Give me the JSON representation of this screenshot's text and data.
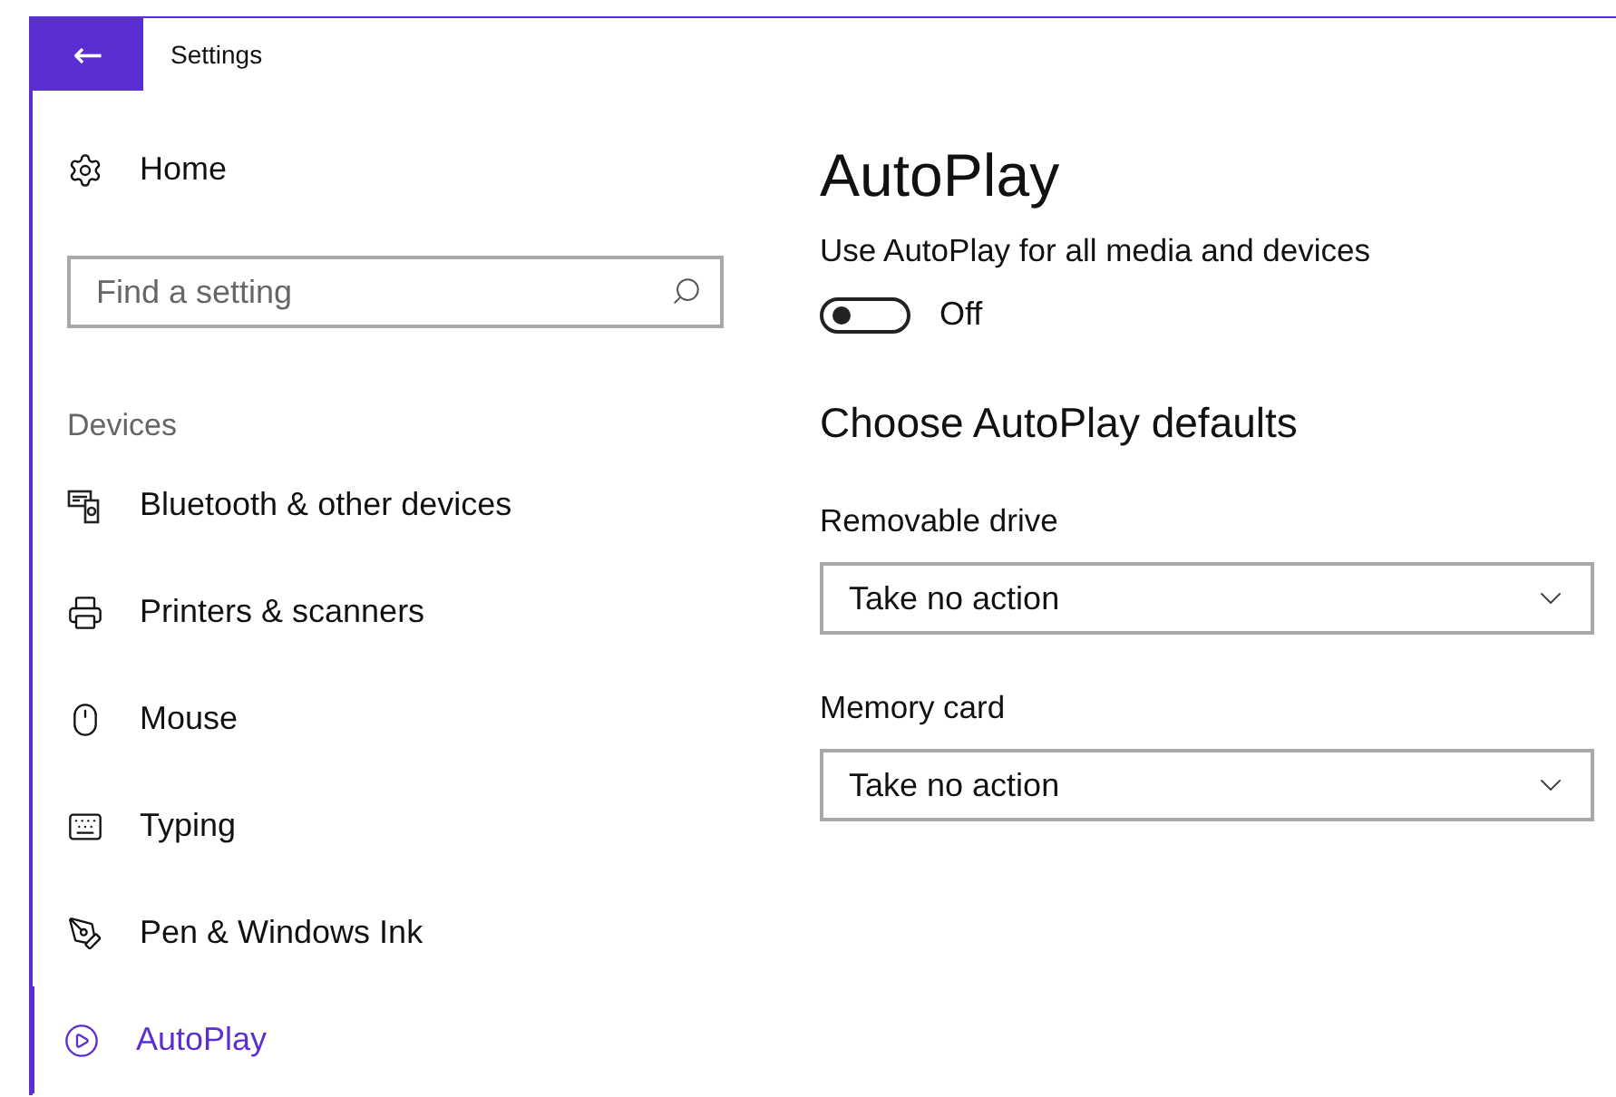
{
  "window": {
    "title": "Settings",
    "back": "←"
  },
  "sidebar": {
    "home": "Home",
    "search": {
      "placeholder": "Find a setting"
    },
    "section": "Devices",
    "items": [
      {
        "label": "Bluetooth & other devices",
        "kind": "devices",
        "selected": false
      },
      {
        "label": "Printers & scanners",
        "kind": "printer",
        "selected": false
      },
      {
        "label": "Mouse",
        "kind": "mouse",
        "selected": false
      },
      {
        "label": "Typing",
        "kind": "keyboard",
        "selected": false
      },
      {
        "label": "Pen & Windows Ink",
        "kind": "pen",
        "selected": false
      },
      {
        "label": "AutoPlay",
        "kind": "autoplay",
        "selected": true
      }
    ]
  },
  "content": {
    "title": "AutoPlay",
    "toggle": {
      "label": "Use AutoPlay for all media and devices",
      "on": false,
      "state_text": "Off"
    },
    "subtitle": "Choose AutoPlay defaults",
    "dropdowns": [
      {
        "label": "Removable drive",
        "value": "Take no action"
      },
      {
        "label": "Memory card",
        "value": "Take no action"
      }
    ]
  }
}
